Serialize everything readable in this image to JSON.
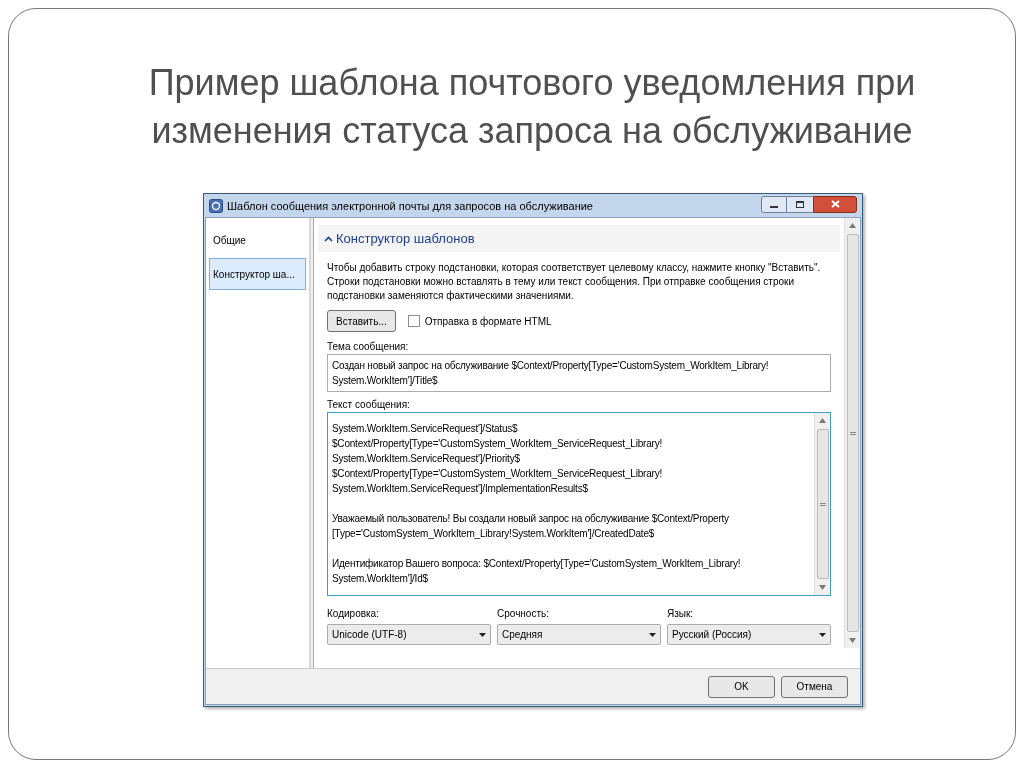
{
  "slide_title_lines": [
    "Пример шаблона почтового уведомления при",
    "изменения статуса запроса на обслуживание"
  ],
  "dialog": {
    "title": "Шаблон сообщения электронной почты для запросов на обслуживание",
    "nav": [
      {
        "label": "Общие",
        "selected": false
      },
      {
        "label": "Конструктор ша...",
        "selected": true
      }
    ],
    "section": {
      "title": "Конструктор шаблонов",
      "expanded": true,
      "description": "Чтобы добавить строку подстановки, которая соответствует целевому классу, нажмите кнопку \"Вставить\". Строки подстановки можно вставлять в тему или текст сообщения. При отправке сообщения строки подстановки заменяются фактическими значениями.",
      "insert_button": "Вставить...",
      "html_checkbox": {
        "label": "Отправка в формате HTML",
        "checked": false
      },
      "subject": {
        "label": "Тема сообщения:",
        "lines": [
          "Создан новый запрос на обслуживание $Context/Property[Type='CustomSystem_WorkItem_Library!",
          "System.WorkItem']/Title$"
        ]
      },
      "body": {
        "label": "Текст сообщения:",
        "paragraphs": [
          [
            "System.WorkItem.ServiceRequest']/Status$",
            "$Context/Property[Type='CustomSystem_WorkItem_ServiceRequest_Library!",
            "System.WorkItem.ServiceRequest']/Priority$",
            "$Context/Property[Type='CustomSystem_WorkItem_ServiceRequest_Library!",
            "System.WorkItem.ServiceRequest']/ImplementationResults$"
          ],
          [
            "Уважаемый пользователь! Вы создали новый запрос на обслуживание $Context/Property",
            "[Type='CustomSystem_WorkItem_Library!System.WorkItem']/CreatedDate$"
          ],
          [
            "Идентификатор Вашего вопроса: $Context/Property[Type='CustomSystem_WorkItem_Library!",
            "System.WorkItem']/Id$"
          ]
        ]
      },
      "dropdowns": [
        {
          "label": "Кодировка:",
          "value": "Unicode (UTF-8)"
        },
        {
          "label": "Срочность:",
          "value": "Средняя"
        },
        {
          "label": "Язык:",
          "value": "Русский (Россия)"
        }
      ]
    },
    "buttons": [
      "OK",
      "Отмена"
    ]
  }
}
